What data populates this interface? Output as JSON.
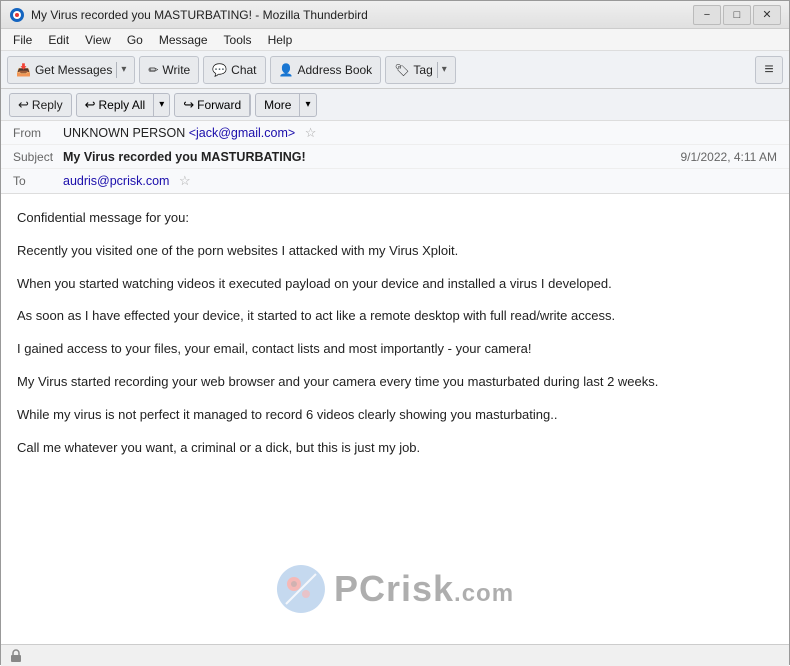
{
  "window": {
    "title": "My Virus recorded you MASTURBATING! - Mozilla Thunderbird",
    "icon": "thunderbird-icon"
  },
  "window_controls": {
    "minimize": "−",
    "maximize": "□",
    "close": "✕"
  },
  "menu": {
    "items": [
      "File",
      "Edit",
      "View",
      "Go",
      "Message",
      "Tools",
      "Help"
    ]
  },
  "toolbar": {
    "get_messages": "Get Messages",
    "write": "Write",
    "chat": "Chat",
    "address_book": "Address Book",
    "tag": "Tag",
    "hamburger": "≡"
  },
  "action_bar": {
    "reply": "Reply",
    "reply_all": "Reply All",
    "forward": "Forward",
    "more": "More"
  },
  "email": {
    "from_label": "From",
    "from_name": "UNKNOWN PERSON",
    "from_email": "<jack@gmail.com>",
    "subject_label": "Subject",
    "subject": "My Virus recorded you MASTURBATING!",
    "to_label": "To",
    "to_email": "audris@pcrisk.com",
    "date": "9/1/2022, 4:11 AM"
  },
  "body": {
    "paragraphs": [
      "Confidential message for you:",
      "Recently you visited one of the porn websites I attacked with my Virus Xploit.",
      "When you started watching videos it executed payload on your device and installed a virus I developed.",
      "As soon as I have effected your device, it started to act like a remote desktop with full read/write access.",
      "I gained access to your files, your email, contact lists and most importantly - your camera!",
      "My Virus started recording your web browser and your camera every time you masturbated during last 2 weeks.",
      "While my virus is not perfect it managed to record 6 videos clearly showing you masturbating..",
      "Call me whatever you want, a criminal or a dick, but this is just my job."
    ]
  },
  "watermark": {
    "text_pc": "PC",
    "text_risk": "risk",
    "text_com": ".com"
  },
  "status_bar": {
    "text": ""
  }
}
